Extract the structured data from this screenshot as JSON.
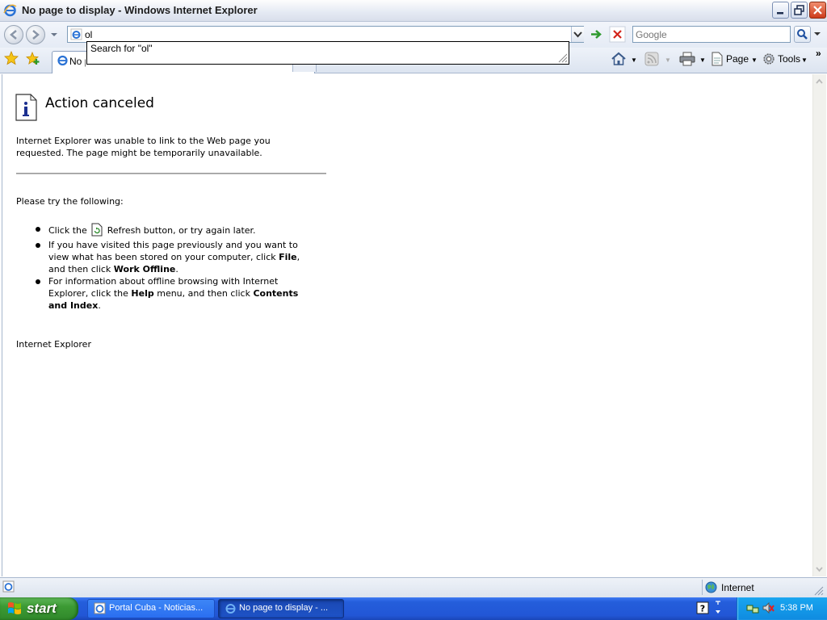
{
  "window": {
    "title": "No page to display - Windows Internet Explorer"
  },
  "address": {
    "value": "ol",
    "autocomplete": "Search for \"ol\""
  },
  "search": {
    "placeholder": "Google"
  },
  "tab": {
    "label": "No page to display"
  },
  "command_bar": {
    "page_label": "Page",
    "tools_label": "Tools"
  },
  "content": {
    "heading": "Action canceled",
    "paragraph": "Internet Explorer was unable to link to the Web page you requested. The page might be temporarily unavailable.",
    "try_label": "Please try the following:",
    "item1_pre": "Click the",
    "item1_post": "Refresh button, or try again later.",
    "item2_pre": "If you have visited this page previously and you want to view what has been stored on your computer, click ",
    "item2_file": "File",
    "item2_mid": ", and then click ",
    "item2_offline": "Work Offline",
    "item2_end": ".",
    "item3_pre": "For information about offline browsing with Internet Explorer, click the ",
    "item3_help": "Help",
    "item3_mid": " menu, and then click ",
    "item3_contents": "Contents and Index",
    "item3_end": ".",
    "footer": "Internet Explorer"
  },
  "status": {
    "zone": "Internet"
  },
  "taskbar": {
    "start_label": "start",
    "items": [
      {
        "label": "Portal Cuba - Noticias..."
      },
      {
        "label": "No page to display - ..."
      }
    ],
    "clock": "5:38 PM"
  },
  "colors": {
    "taskbar_blue": "#245edb",
    "start_green": "#3c9a34",
    "tray_blue": "#0f8be0"
  }
}
